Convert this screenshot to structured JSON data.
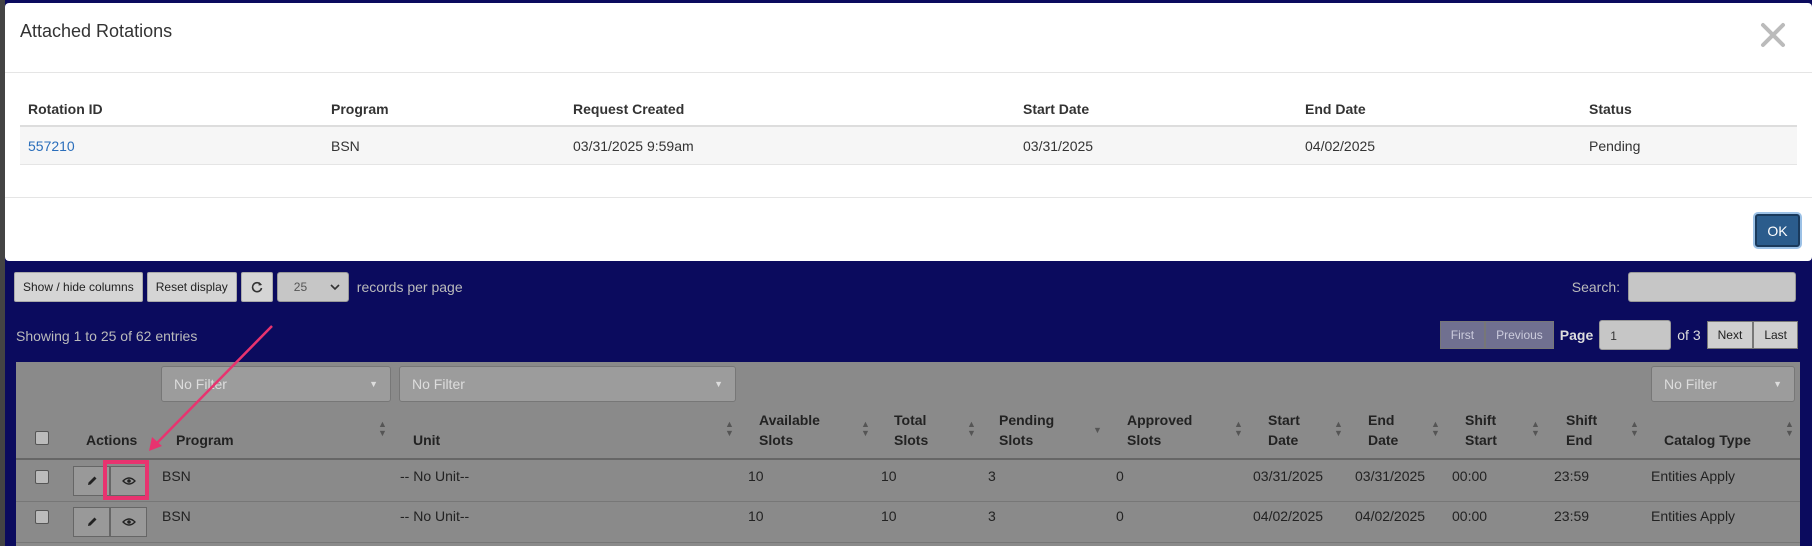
{
  "modal": {
    "title": "Attached Rotations",
    "close_icon": "close-icon",
    "columns": [
      "Rotation ID",
      "Program",
      "Request Created",
      "Start Date",
      "End Date",
      "Status"
    ],
    "rows": [
      {
        "rotation_id": "557210",
        "program": "BSN",
        "request_created": "03/31/2025 9:59am",
        "start_date": "03/31/2025",
        "end_date": "04/02/2025",
        "status": "Pending"
      }
    ],
    "ok_label": "OK"
  },
  "toolbar": {
    "show_hide_label": "Show / hide columns",
    "reset_label": "Reset display",
    "refresh_icon": "refresh-icon",
    "page_size": "25",
    "records_per_page": "records per page",
    "search_label": "Search:",
    "search_value": ""
  },
  "info": {
    "showing": "Showing 1 to 25 of 62 entries"
  },
  "pager": {
    "first": "First",
    "previous": "Previous",
    "page_label": "Page",
    "page_value": "1",
    "of_label": "of 3",
    "next": "Next",
    "last": "Last"
  },
  "filters": {
    "program": "No Filter",
    "unit": "No Filter",
    "catalog": "No Filter"
  },
  "grid": {
    "headers": {
      "actions": "Actions",
      "program": "Program",
      "unit": "Unit",
      "available_1": "Available",
      "available_2": "Slots",
      "total_1": "Total",
      "total_2": "Slots",
      "pending_1": "Pending",
      "pending_2": "Slots",
      "approved_1": "Approved",
      "approved_2": "Slots",
      "start_1": "Start",
      "start_2": "Date",
      "end_1": "End",
      "end_2": "Date",
      "shift_start_1": "Shift",
      "shift_start_2": "Start",
      "shift_end_1": "Shift",
      "shift_end_2": "End",
      "catalog": "Catalog Type"
    },
    "rows": [
      {
        "program": "BSN",
        "unit": "-- No Unit--",
        "available": "10",
        "total": "10",
        "pending": "3",
        "approved": "0",
        "start": "03/31/2025",
        "end": "03/31/2025",
        "shift_start": "00:00",
        "shift_end": "23:59",
        "catalog": "Entities Apply"
      },
      {
        "program": "BSN",
        "unit": "-- No Unit--",
        "available": "10",
        "total": "10",
        "pending": "3",
        "approved": "0",
        "start": "04/02/2025",
        "end": "04/02/2025",
        "shift_start": "00:00",
        "shift_end": "23:59",
        "catalog": "Entities Apply"
      }
    ]
  },
  "colors": {
    "backdrop": "#0b0b5e",
    "highlight": "#e8336f",
    "link": "#2a6ebb",
    "ok_button": "#2b5c8c"
  }
}
